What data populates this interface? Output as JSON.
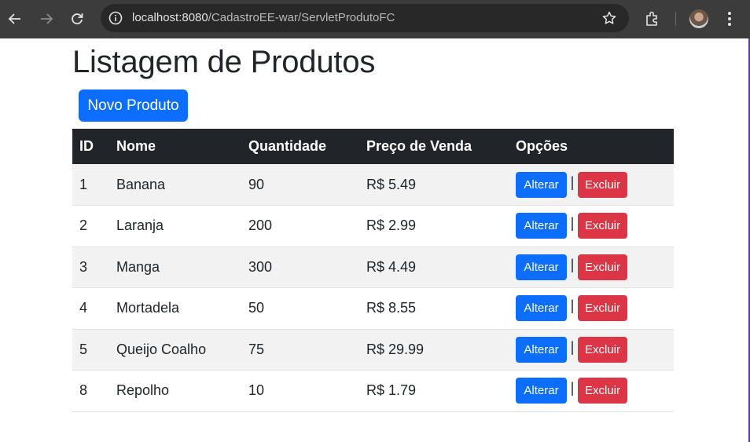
{
  "browser": {
    "url_host": "localhost:8080",
    "url_path": "/CadastroEE-war/ServletProdutoFC"
  },
  "page": {
    "title": "Listagem de Produtos",
    "new_button_label": "Novo Produto"
  },
  "table": {
    "headers": [
      "ID",
      "Nome",
      "Quantidade",
      "Preço de Venda",
      "Opções"
    ],
    "rows": [
      {
        "id": "1",
        "nome": "Banana",
        "quantidade": "90",
        "preco": "R$ 5.49"
      },
      {
        "id": "2",
        "nome": "Laranja",
        "quantidade": "200",
        "preco": "R$ 2.99"
      },
      {
        "id": "3",
        "nome": "Manga",
        "quantidade": "300",
        "preco": "R$ 4.49"
      },
      {
        "id": "4",
        "nome": "Mortadela",
        "quantidade": "50",
        "preco": "R$ 8.55"
      },
      {
        "id": "5",
        "nome": "Queijo Coalho",
        "quantidade": "75",
        "preco": "R$ 29.99"
      },
      {
        "id": "8",
        "nome": "Repolho",
        "quantidade": "10",
        "preco": "R$ 1.79"
      }
    ],
    "alterar_label": "Alterar",
    "excluir_label": "Excluir",
    "separator": "|"
  },
  "colors": {
    "primary": "#0d6efd",
    "danger": "#dc3545",
    "table_header_bg": "#212529",
    "browser_bar": "#3c3c3c"
  },
  "icons": [
    "back-arrow-icon",
    "forward-arrow-icon",
    "reload-icon",
    "site-info-icon",
    "bookmark-star-icon",
    "extensions-icon",
    "profile-avatar",
    "menu-kebab-icon"
  ]
}
